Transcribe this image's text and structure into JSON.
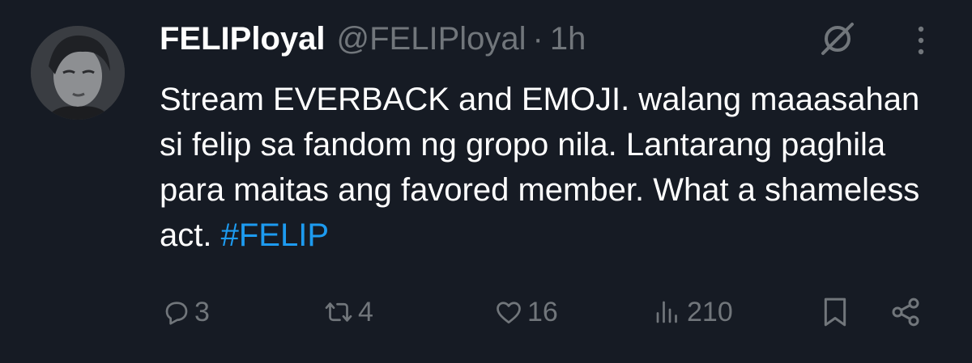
{
  "tweet": {
    "display_name": "FELIPloyal",
    "handle": "@FELIPloyal",
    "separator": "·",
    "time": "1h",
    "text": "Stream EVERBACK and EMOJI. walang maaasahan si felip sa fandom ng gropo nila. Lantarang paghila para maitas ang favored member. What a shameless act. ",
    "hashtag": "#FELIP"
  },
  "actions": {
    "replies": "3",
    "reposts": "4",
    "likes": "16",
    "views": "210"
  },
  "icons": {
    "avatar": "profile-photo",
    "grok": "grok-icon",
    "more": "more-vertical-icon",
    "reply": "reply-icon",
    "repost": "repost-icon",
    "like": "heart-icon",
    "views": "views-icon",
    "bookmark": "bookmark-icon",
    "share": "share-icon"
  },
  "colors": {
    "background": "#161b24",
    "text": "#ffffff",
    "secondary": "#71767b",
    "link": "#1d9bf0"
  }
}
